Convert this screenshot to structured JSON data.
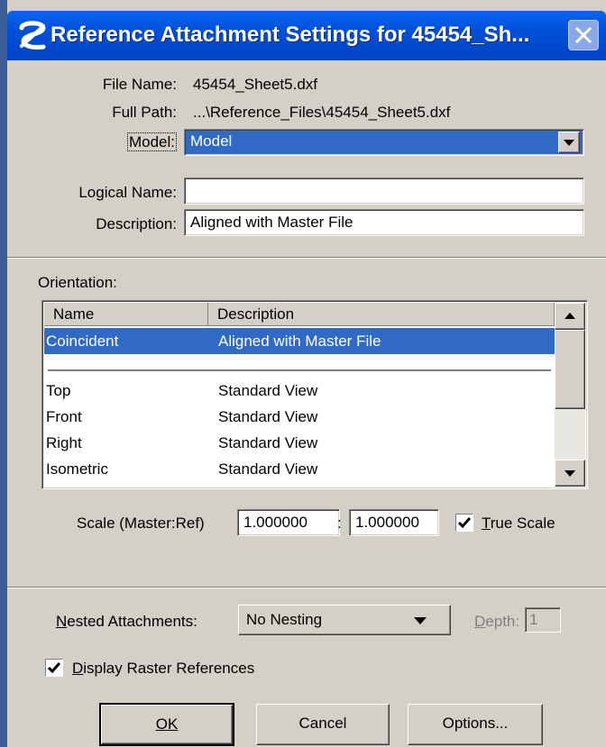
{
  "window": {
    "title": "Reference Attachment Settings for 45454_Sh..."
  },
  "file": {
    "file_name_label": "File Name:",
    "file_name_value": "45454_Sheet5.dxf",
    "full_path_label": "Full Path:",
    "full_path_value": "...\\Reference_Files\\45454_Sheet5.dxf",
    "model_label": "Model:",
    "model_value": "Model",
    "logical_name_label": "Logical Name:",
    "logical_name_value": "",
    "description_label": "Description:",
    "description_value": "Aligned with Master File"
  },
  "orientation": {
    "label": "Orientation:",
    "columns": [
      "Name",
      "Description"
    ],
    "rows": [
      {
        "name": "Coincident",
        "description": "Aligned with Master File",
        "selected": true
      },
      {
        "name": "Top",
        "description": "Standard View"
      },
      {
        "name": "Front",
        "description": "Standard View"
      },
      {
        "name": "Right",
        "description": "Standard View"
      },
      {
        "name": "Isometric",
        "description": "Standard View"
      }
    ]
  },
  "scale": {
    "label": "Scale (Master:Ref)",
    "master_value": "1.000000",
    "separator": ":",
    "ref_value": "1.000000",
    "true_scale_label": "True Scale",
    "true_scale_checked": true
  },
  "nesting": {
    "label": "Nested Attachments:",
    "value": "No Nesting",
    "depth_label": "Depth:",
    "depth_value": "1"
  },
  "raster": {
    "label": "Display Raster References",
    "checked": true
  },
  "buttons": {
    "ok": "OK",
    "cancel": "Cancel",
    "options": "Options..."
  },
  "colors": {
    "titlebar": "#0250d8",
    "selection": "#316ac5",
    "face": "#d4d0c8"
  }
}
